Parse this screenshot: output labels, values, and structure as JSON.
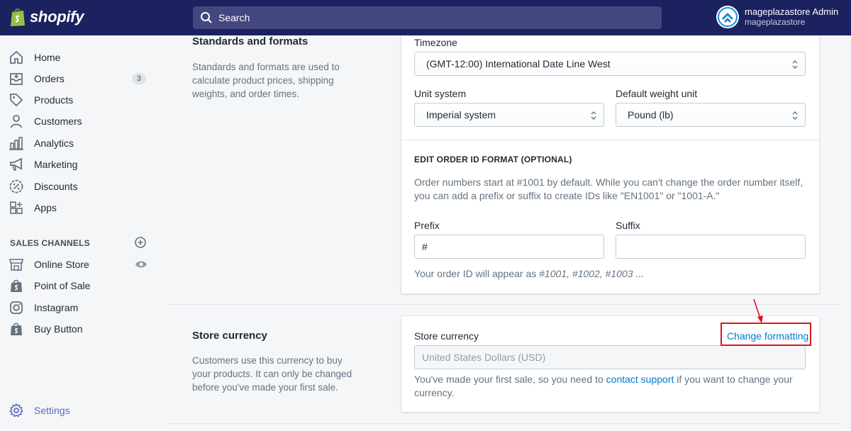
{
  "header": {
    "brand": "shopify",
    "search_placeholder": "Search",
    "account_name": "mageplazastore Admin",
    "account_store": "mageplazastore"
  },
  "sidebar": {
    "items": [
      {
        "label": "Home",
        "icon": "home-icon"
      },
      {
        "label": "Orders",
        "icon": "orders-icon",
        "badge": "3"
      },
      {
        "label": "Products",
        "icon": "tag-icon"
      },
      {
        "label": "Customers",
        "icon": "person-icon"
      },
      {
        "label": "Analytics",
        "icon": "bar-chart-icon"
      },
      {
        "label": "Marketing",
        "icon": "megaphone-icon"
      },
      {
        "label": "Discounts",
        "icon": "discount-icon"
      },
      {
        "label": "Apps",
        "icon": "apps-icon"
      }
    ],
    "sales_channels_title": "SALES CHANNELS",
    "channels": [
      {
        "label": "Online Store",
        "icon": "store-icon"
      },
      {
        "label": "Point of Sale",
        "icon": "shopping-bag-icon"
      },
      {
        "label": "Instagram",
        "icon": "instagram-icon"
      },
      {
        "label": "Buy Button",
        "icon": "shopping-bag-icon"
      }
    ],
    "settings_label": "Settings"
  },
  "standards": {
    "title": "Standards and formats",
    "description": "Standards and formats are used to calculate product prices, shipping weights, and order times.",
    "timezone_label": "Timezone",
    "timezone_value": "(GMT-12:00) International Date Line West",
    "unit_system_label": "Unit system",
    "unit_system_value": "Imperial system",
    "weight_unit_label": "Default weight unit",
    "weight_unit_value": "Pound (lb)",
    "order_id_heading": "EDIT ORDER ID FORMAT (OPTIONAL)",
    "order_id_help": "Order numbers start at #1001 by default. While you can't change the order number itself, you can add a prefix or suffix to create IDs like \"EN1001\" or \"1001-A.\"",
    "prefix_label": "Prefix",
    "prefix_value": "#",
    "suffix_label": "Suffix",
    "suffix_value": "",
    "preview_text": "Your order ID will appear as ",
    "preview_ids": "#1001, #1002, #1003 ..."
  },
  "currency": {
    "title": "Store currency",
    "description": "Customers use this currency to buy your products. It can only be changed before you've made your first sale.",
    "field_label": "Store currency",
    "change_link": "Change formatting",
    "value": "United States Dollars (USD)",
    "help_before": "You've made your first sale, so you need to ",
    "help_link": "contact support",
    "help_after": " if you want to change your currency."
  },
  "colors": {
    "topbar": "#1c2260",
    "accent": "#5c6ac4",
    "link": "#007ace",
    "annotation": "#e0141e"
  }
}
